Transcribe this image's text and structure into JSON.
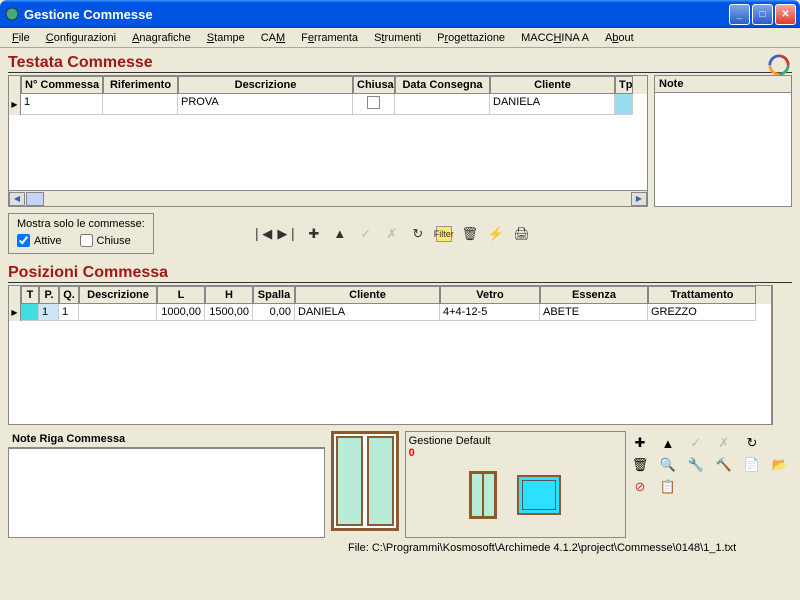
{
  "window": {
    "title": "Gestione Commesse"
  },
  "menu": [
    "File",
    "Configurazioni",
    "Anagrafiche",
    "Stampe",
    "CAM",
    "Ferramenta",
    "Strumenti",
    "Progettazione",
    "MACCHINA A",
    "About"
  ],
  "section1_title": "Testata Commesse",
  "grid1": {
    "headers": [
      "N° Commessa",
      "Riferimento",
      "Descrizione",
      "Chiusa",
      "Data Consegna",
      "Cliente",
      "Tp"
    ],
    "row": {
      "num": "1",
      "rif": "",
      "desc": "PROVA",
      "chiusa": "",
      "consegna": "",
      "cliente": "DANIELA",
      "tp": ""
    }
  },
  "note_label": "Note",
  "filter": {
    "label": "Mostra solo le commesse:",
    "opt_attive": "Attive",
    "opt_chiuse": "Chiuse"
  },
  "section2_title": "Posizioni Commessa",
  "grid2": {
    "headers": [
      "T",
      "P.",
      "Q.",
      "Descrizione",
      "L",
      "H",
      "Spalla",
      "Cliente",
      "Vetro",
      "Essenza",
      "Trattamento"
    ],
    "row": {
      "t": "",
      "p": "1",
      "q": "1",
      "desc": "",
      "l": "1000,00",
      "h": "1500,00",
      "spalla": "0,00",
      "cliente": "DANIELA",
      "vetro": "4+4-12-5",
      "essenza": "ABETE",
      "tratt": "GREZZO"
    }
  },
  "note_riga_label": "Note   Riga Commessa",
  "gestione": {
    "title": "Gestione Default",
    "num": "0"
  },
  "file_path": "File: C:\\Programmi\\Kosmosoft\\Archimede 4.1.2\\project\\Commesse\\0148\\1_1.txt"
}
